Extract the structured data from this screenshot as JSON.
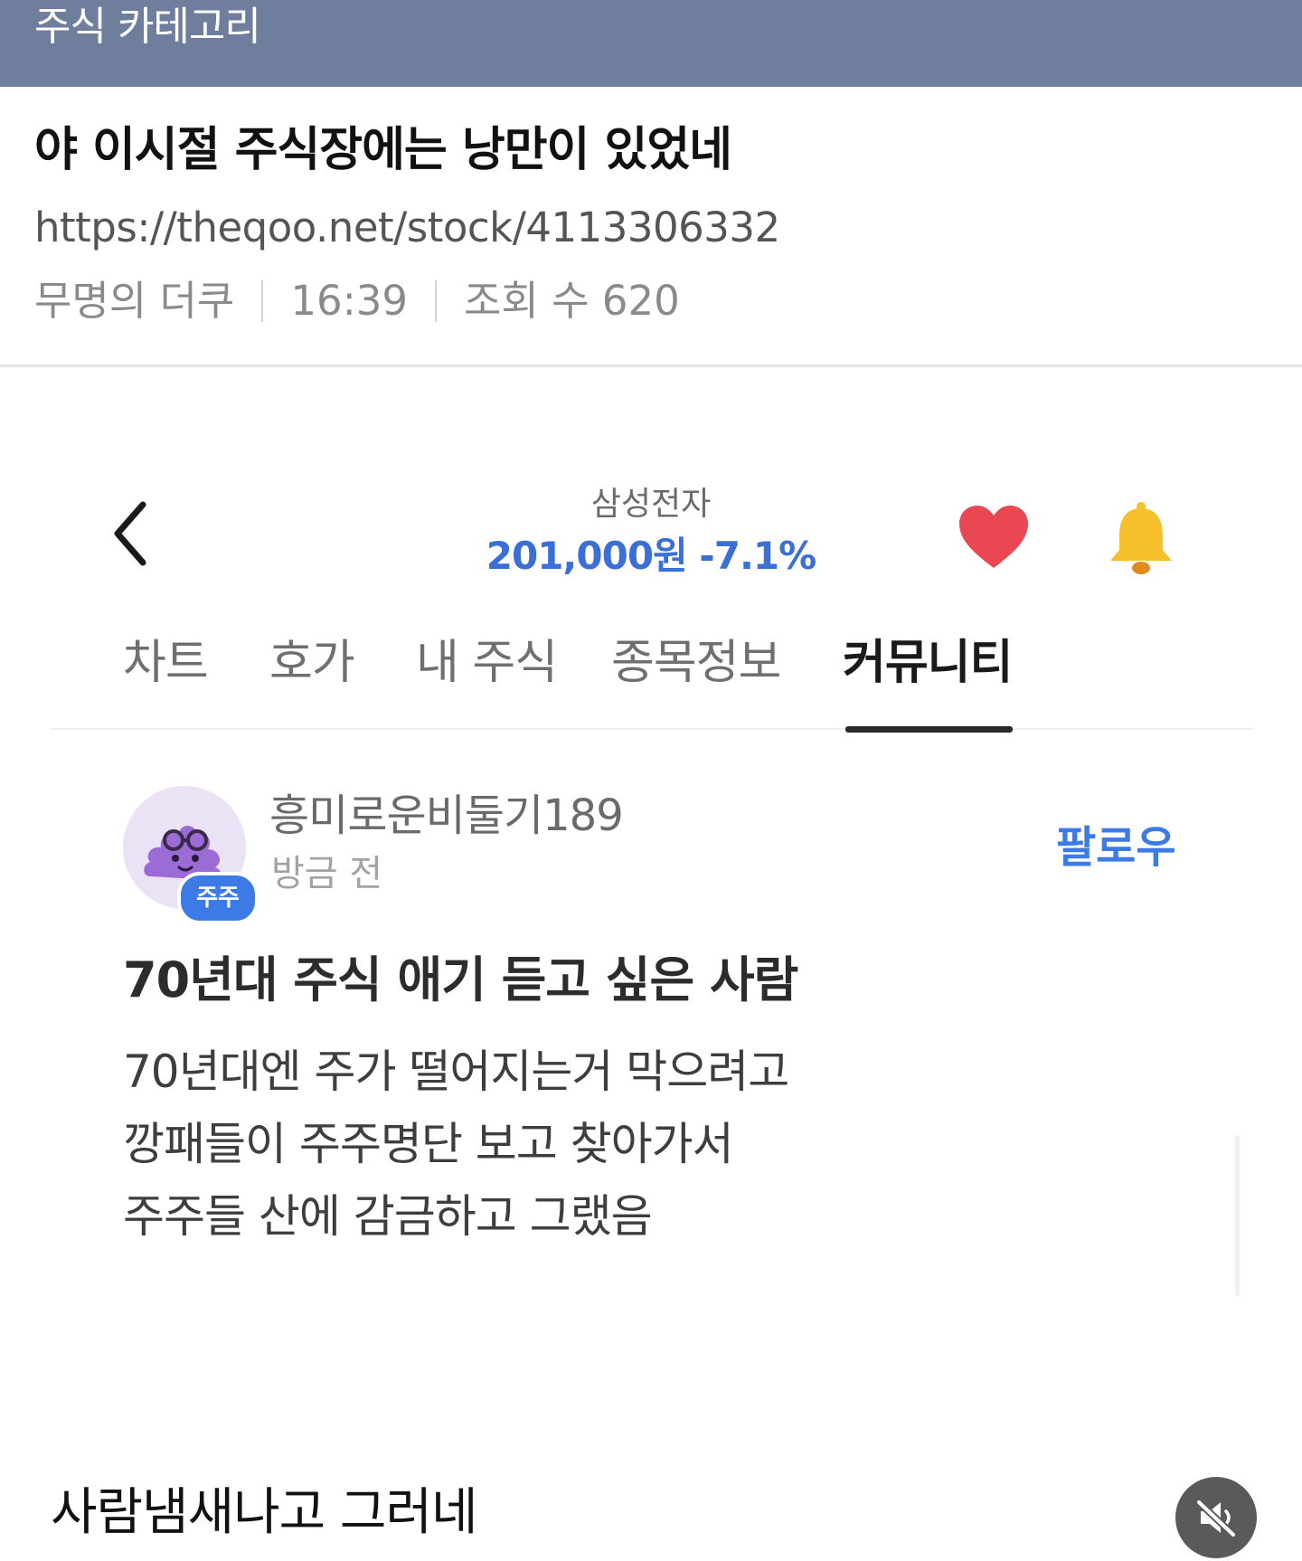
{
  "category": {
    "title": "주식 카테고리"
  },
  "post": {
    "title": "야 이시절 주식장에는 낭만이 있었네",
    "url": "https://theqoo.net/stock/4113306332",
    "author": "무명의 더쿠",
    "time": "16:39",
    "views": "조회 수 620"
  },
  "app": {
    "icons": {
      "back": "chevron-left-icon",
      "favorite": "heart-icon",
      "alert": "bell-icon"
    },
    "stock": {
      "name": "삼성전자",
      "price": "201,000원 -7.1%"
    },
    "colors": {
      "price": "#3a6fd8",
      "heart": "#e94853",
      "bell": "#f5c02b",
      "accent": "#3c7be5"
    },
    "tabs": [
      {
        "label": "차트",
        "active": false
      },
      {
        "label": "호가",
        "active": false
      },
      {
        "label": "내 주식",
        "active": false
      },
      {
        "label": "종목정보",
        "active": false
      },
      {
        "label": "커뮤니티",
        "active": true
      }
    ],
    "community_post": {
      "author": "흥미로운비둘기189",
      "badge": "주주",
      "time": "방금 전",
      "follow_label": "팔로우",
      "title": "70년대 주식 애기 듣고 싶은 사람",
      "body_lines": [
        "70년대엔 주가 떨어지는거 막으려고",
        "깡패들이 주주명단 보고 찾아가서",
        "주주들 산에 감금하고 그랬음"
      ]
    }
  },
  "caption": "사람냄새나고 그러네",
  "mute_icon": "speaker-muted-icon"
}
